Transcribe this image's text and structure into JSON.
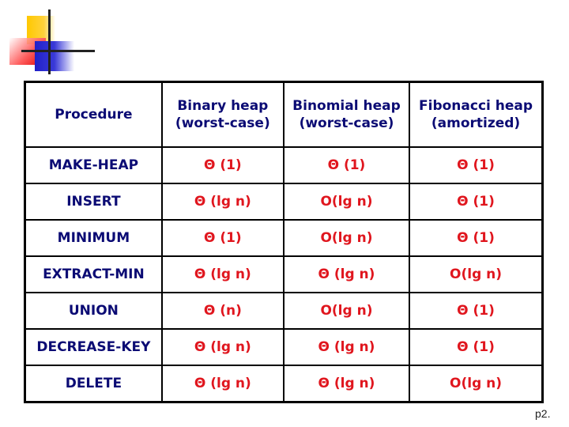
{
  "table": {
    "headers": [
      {
        "line1": "Procedure",
        "line2": ""
      },
      {
        "line1": "Binary heap",
        "line2": "(worst-case)"
      },
      {
        "line1": "Binomial heap",
        "line2": "(worst-case)"
      },
      {
        "line1": "Fibonacci heap",
        "line2": "(amortized)"
      }
    ],
    "rows": [
      {
        "procedure": "MAKE-HEAP",
        "binary": "Θ (1)",
        "binomial": "Θ (1)",
        "fibonacci": "Θ (1)"
      },
      {
        "procedure": "INSERT",
        "binary": "Θ (lg n)",
        "binomial": "O(lg n)",
        "fibonacci": "Θ (1)"
      },
      {
        "procedure": "MINIMUM",
        "binary": "Θ (1)",
        "binomial": "O(lg n)",
        "fibonacci": "Θ (1)"
      },
      {
        "procedure": "EXTRACT-MIN",
        "binary": "Θ (lg n)",
        "binomial": "Θ (lg n)",
        "fibonacci": "O(lg n)"
      },
      {
        "procedure": "UNION",
        "binary": "Θ (n)",
        "binomial": "O(lg n)",
        "fibonacci": "Θ (1)"
      },
      {
        "procedure": "DECREASE-KEY",
        "binary": "Θ (lg n)",
        "binomial": "Θ (lg n)",
        "fibonacci": "Θ (1)"
      },
      {
        "procedure": "DELETE",
        "binary": "Θ (lg n)",
        "binomial": "Θ (lg n)",
        "fibonacci": "O(lg n)"
      }
    ]
  },
  "page_number": "p2.",
  "colors": {
    "header_text": "#0b0b74",
    "value_text": "#e0161e"
  }
}
